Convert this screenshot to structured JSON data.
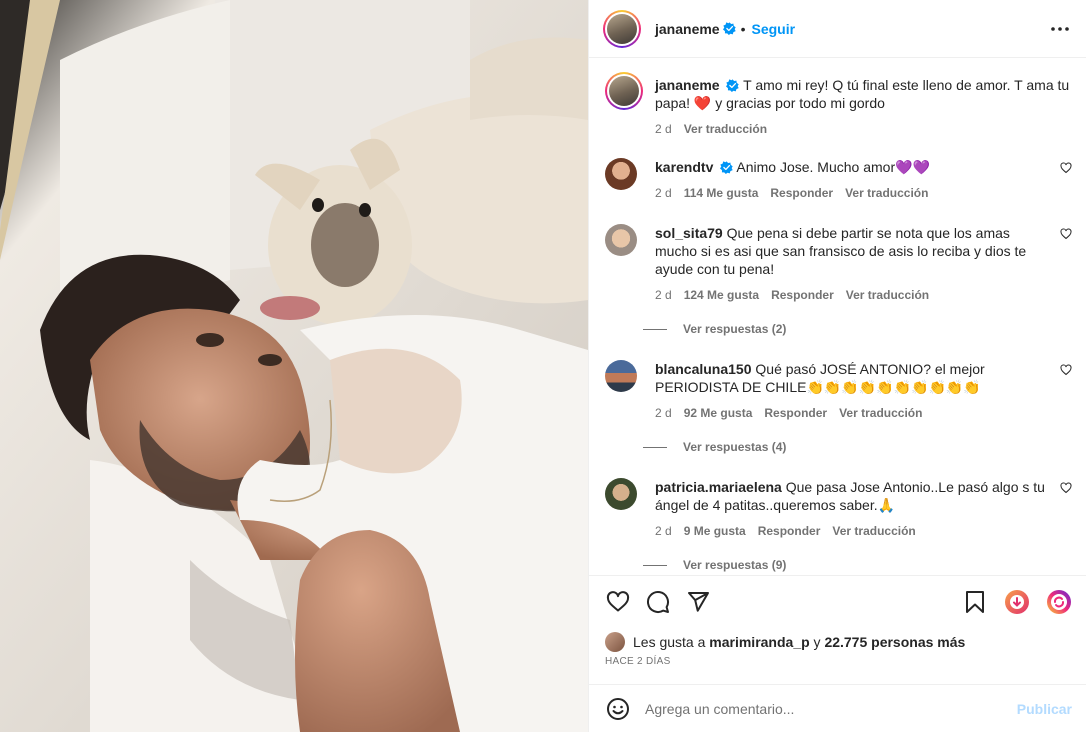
{
  "post": {
    "username": "jananeme",
    "follow_label": "Seguir",
    "dot": "•",
    "caption": "T amo mi rey! Q tú final este lleno de amor. T ama tu papa! ❤️ y gracias por todo mi gordo",
    "caption_time": "2 d",
    "translate_label": "Ver traducción"
  },
  "comments": [
    {
      "user": "karendtv",
      "verified": true,
      "text": "Animo Jose. Mucho amor💜💜",
      "time": "2 d",
      "likes": "114 Me gusta",
      "reply": "Responder",
      "translate": "Ver traducción",
      "replies_label": ""
    },
    {
      "user": "sol_sita79",
      "verified": false,
      "text": "Que pena si debe partir se nota que los amas mucho si es asi que san fransisco de asis lo reciba y dios te ayude con tu pena!",
      "time": "2 d",
      "likes": "124 Me gusta",
      "reply": "Responder",
      "translate": "Ver traducción",
      "replies_label": "Ver respuestas (2)"
    },
    {
      "user": "blancaluna150",
      "verified": false,
      "text": "Qué pasó JOSÉ ANTONIO? el mejor PERIODISTA DE CHILE👏👏👏👏👏👏👏👏👏👏",
      "time": "2 d",
      "likes": "92 Me gusta",
      "reply": "Responder",
      "translate": "Ver traducción",
      "replies_label": "Ver respuestas (4)"
    },
    {
      "user": "patricia.mariaelena",
      "verified": false,
      "text": "Que pasa Jose Antonio..Le pasó algo s tu ángel de 4 patitas..queremos saber.🙏",
      "time": "2 d",
      "likes": "9 Me gusta",
      "reply": "Responder",
      "translate": "Ver traducción",
      "replies_label": "Ver respuestas (9)"
    }
  ],
  "likes": {
    "prefix": "Les gusta a ",
    "user": "marimiranda_p",
    "middle": " y ",
    "count": "22.775 personas más"
  },
  "time_ago": "HACE 2 DÍAS",
  "add_comment": {
    "placeholder": "Agrega un comentario...",
    "post_label": "Publicar"
  },
  "colors": {
    "accent": "#0095f6",
    "post_disabled": "#b3dbff",
    "muted": "#737373"
  },
  "icons": [
    "heart-icon",
    "comment-icon",
    "share-icon",
    "bookmark-icon",
    "more-icon",
    "emoji-icon",
    "verified-icon"
  ]
}
